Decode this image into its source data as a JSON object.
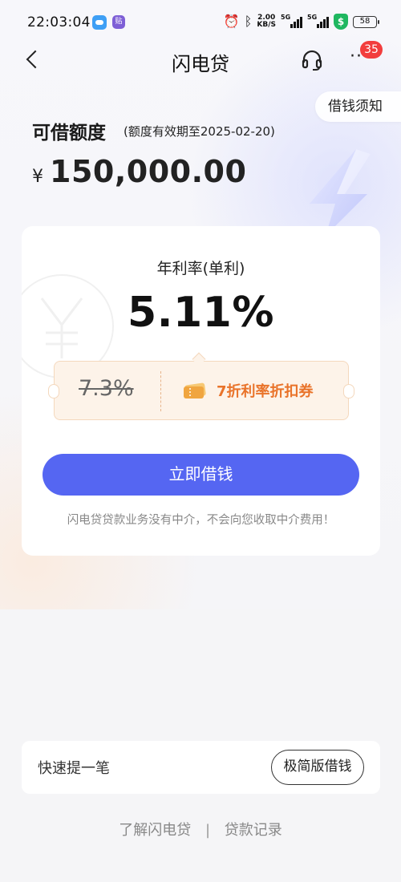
{
  "status_bar": {
    "time": "22:03:04",
    "app2_glyph": "贴",
    "speed_value": "2.00",
    "speed_unit": "KB/S",
    "sim1_label": "5G",
    "sim2_label": "5G",
    "shield_glyph": "$",
    "battery": "58"
  },
  "nav": {
    "title": "闪电贷",
    "badge_count": "35",
    "more_glyph": "···"
  },
  "notice_tab": "借钱须知",
  "credit": {
    "label": "可借额度",
    "validity": "(额度有效期至2025-02-20)",
    "currency": "¥",
    "amount": "150,000.00"
  },
  "card": {
    "rate_label": "年利率(单利)",
    "rate_value": "5.11%",
    "old_rate": "7.3%",
    "coupon_text": "7折利率折扣券",
    "borrow_button": "立即借钱",
    "disclaimer": "闪电贷贷款业务没有中介，不会向您收取中介费用！"
  },
  "quick": {
    "label": "快速提一笔",
    "button": "极简版借钱"
  },
  "footer": {
    "link1": "了解闪电贷",
    "separator": "|",
    "link2": "贷款记录"
  },
  "colors": {
    "primary_button": "#5566f2",
    "coupon_text": "#e9732a",
    "badge": "#f23d3d",
    "coupon_bg": "#fdf3e9"
  }
}
